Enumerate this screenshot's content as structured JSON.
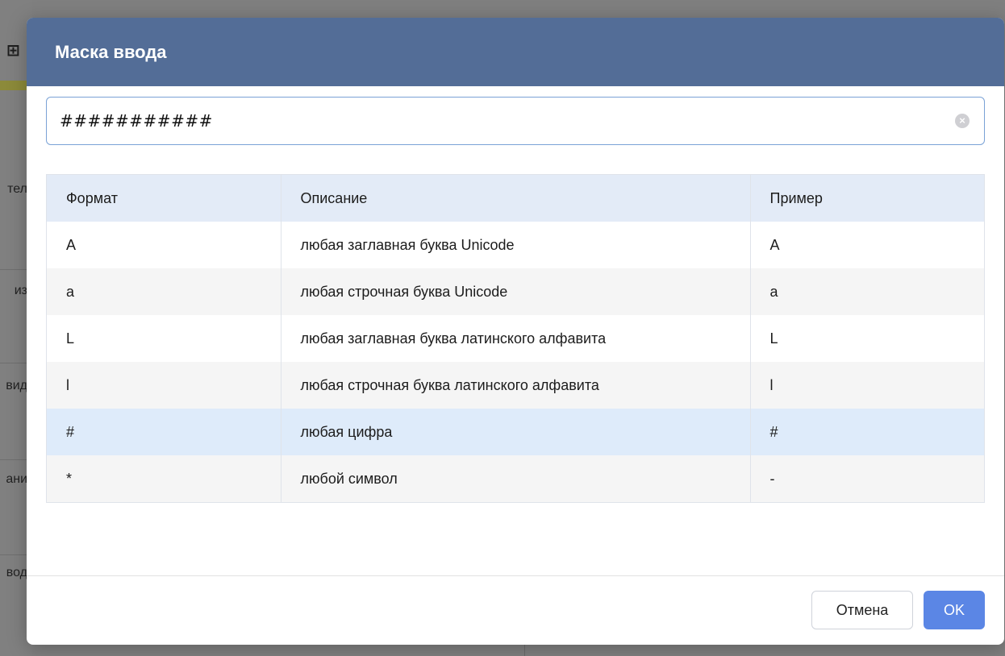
{
  "background": {
    "labels": [
      "тел",
      "из",
      "вид",
      "ани",
      "вод"
    ]
  },
  "dialog": {
    "title": "Маска ввода",
    "mask_input": {
      "value": "###########"
    },
    "table": {
      "headers": [
        "Формат",
        "Описание",
        "Пример"
      ],
      "rows": [
        {
          "format": "A",
          "description": "любая заглавная буква Unicode",
          "example": "A"
        },
        {
          "format": "a",
          "description": "любая строчная буква Unicode",
          "example": "a"
        },
        {
          "format": "L",
          "description": "любая заглавная буква латинского алфавита",
          "example": "L"
        },
        {
          "format": "l",
          "description": "любая строчная буква латинского алфавита",
          "example": "l"
        },
        {
          "format": "#",
          "description": "любая цифра",
          "example": "#",
          "selected": true
        },
        {
          "format": "*",
          "description": "любой символ",
          "example": "-"
        }
      ]
    },
    "buttons": {
      "cancel": "Отмена",
      "ok": "OK"
    }
  },
  "colors": {
    "header_bg": "#536d97",
    "accent": "#5b86e5",
    "selected_row": "#deebfa"
  }
}
